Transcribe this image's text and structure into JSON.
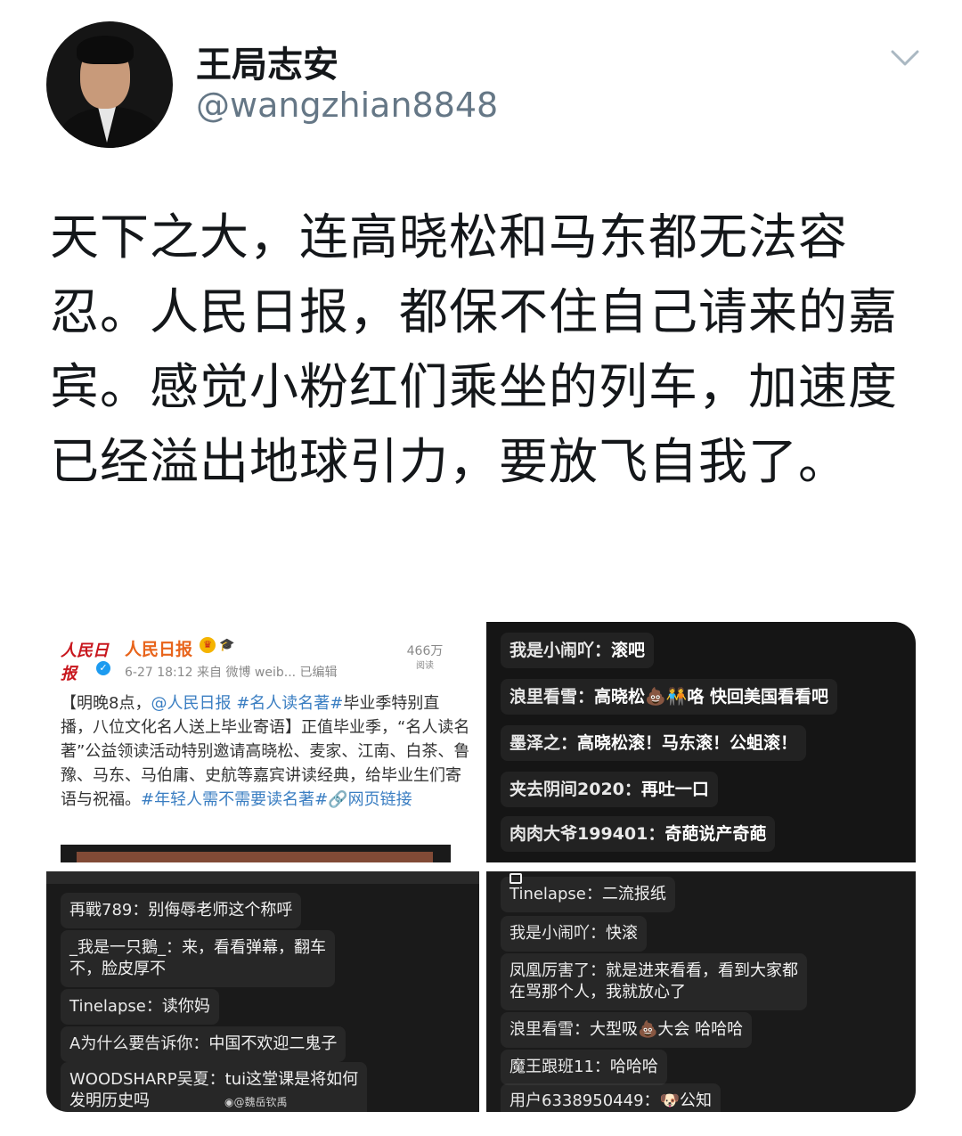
{
  "header": {
    "display_name": "王局志安",
    "handle": "@wangzhian8848",
    "chevron_icon": "chevron-down-icon"
  },
  "tweet": {
    "text": "天下之大，连高晓松和马东都无法容忍。人民日报，都保不住自己请来的嘉宾。感觉小粉红们乘坐的列车，加速度已经溢出地球引力，要放飞自我了。"
  },
  "images": {
    "img1": {
      "logo_text": "人民日报",
      "account": "人民日报",
      "meta": "6-27 18:12  来自 微博 weib...  已编辑",
      "views": "466万",
      "views_label": "阅读",
      "body_1": "【明晚8点，",
      "mention": "@人民日报",
      "tag1": "#名人读名著#",
      "body_2": "毕业季特别直播，八位文化名人送上毕业寄语】正值毕业季，“名人读名著”公益领读活动特别邀请高晓松、麦家、江南、白茶、鲁豫、马东、马伯庸、史航等嘉宾讲读经典，给毕业生们寄语与祝福。",
      "tag2": "#年轻人需不需要读名著#",
      "link": "网页链接"
    },
    "img2": {
      "comments": [
        {
          "user": "我是小闹吖：",
          "text": "滚吧"
        },
        {
          "user": "浪里看雪：",
          "text": "高晓松💩🧑‍🤝‍🧑咯 快回美国看看吧"
        },
        {
          "user": "墨泽之：",
          "text": "高晓松滚！马东滚！公蛆滚！"
        },
        {
          "user": "夹去阴间2020：",
          "text": "再吐一口"
        },
        {
          "user": "肉肉大爷199401：",
          "text": "奇葩说产奇葩"
        }
      ]
    },
    "img3": {
      "comments": [
        {
          "user": "再戰789：",
          "text": "别侮辱老师这个称呼"
        },
        {
          "user": "_我是一只鵝_：",
          "text": "来，看看弹幕，翻车",
          "text2": "不，脸皮厚不"
        },
        {
          "user": "Tinelapse：",
          "text": "读你妈"
        },
        {
          "user": "A为什么要告诉你：",
          "text": "中国不欢迎二鬼子"
        },
        {
          "user": "WOODSHARP吴夏：",
          "text": "tui这堂课是将如何",
          "text2": "发明历史吗"
        }
      ],
      "watermark": "@魏岳钦禹"
    },
    "img4": {
      "comments": [
        {
          "user": "Tinelapse：",
          "text": "二流报纸"
        },
        {
          "user": "我是小闹吖：",
          "text": "快滚"
        },
        {
          "user": "凤凰厉害了：",
          "text": "就是进来看看，看到大家都",
          "text2": "在骂那个人，我就放心了"
        },
        {
          "user": "浪里看雪：",
          "text": "大型吸💩大会 哈哈哈"
        },
        {
          "user": "魔王跟班11：",
          "text": "哈哈哈"
        },
        {
          "user": "用户6338950449：",
          "text": "🐶公知"
        }
      ]
    }
  }
}
